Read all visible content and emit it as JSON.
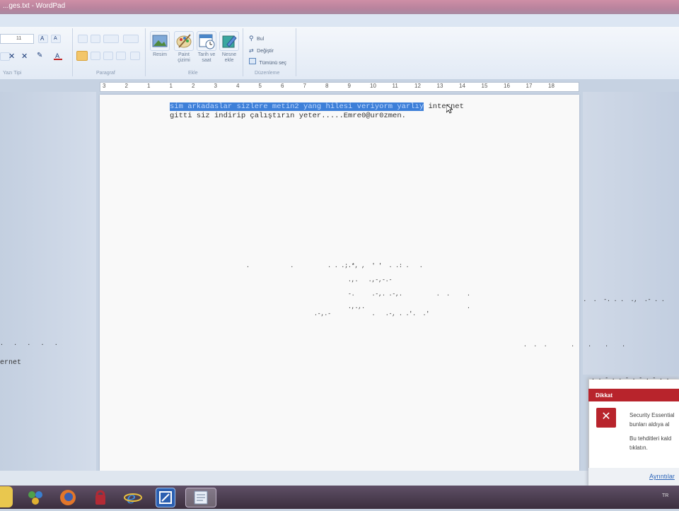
{
  "window": {
    "title": "...ges.txt - WordPad"
  },
  "ribbon": {
    "font_size_value": "11",
    "groups": {
      "font": "Yazı Tipi",
      "paragraph": "Paragraf",
      "insert": "Ekle",
      "editing": "Düzenleme"
    },
    "insert_buttons": [
      "Resim",
      "Paint çizimi",
      "Tarih ve saat",
      "Nesne ekle"
    ],
    "editing_buttons": [
      "Bul",
      "Değiştir",
      "Tümünü seç"
    ]
  },
  "ruler": {
    "marks": [
      "3",
      "2",
      "1",
      "1",
      "2",
      "3",
      "4",
      "5",
      "6",
      "7",
      "8",
      "9",
      "10",
      "11",
      "12",
      "13",
      "14",
      "15",
      "16",
      "17",
      "18"
    ]
  },
  "document": {
    "line1_selected": "sim arkadaslar sizlere metin2 yang hilesi veriyorm yarlıy",
    "line1_rest": "internet",
    "line2": "gitti siz indirip çalıştırın yeter.....Emre0@ur0zmen."
  },
  "behind_window": {
    "left_text": "ernet"
  },
  "notification": {
    "title": "Dikkat",
    "line1": "Security Essential",
    "line2": "bunları aldıya al",
    "line3": "Bu tehditleri kald",
    "line4": "tıklatın.",
    "link": "Ayrıntılar"
  },
  "taskbar": {
    "clock": "TR"
  },
  "colors": {
    "selection": "#3d7fd8",
    "alert_red": "#b8242c",
    "taskbar": "#3b2f3e"
  }
}
